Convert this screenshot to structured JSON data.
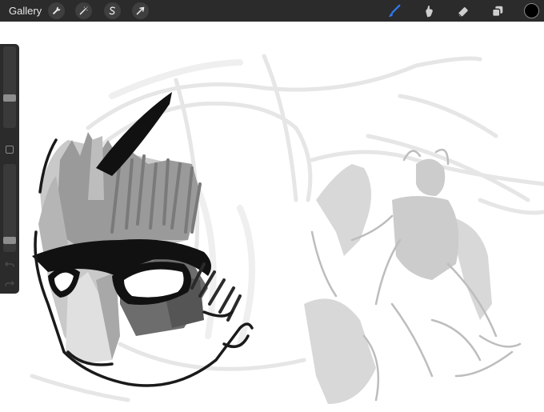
{
  "app": {
    "gallery_label": "Gallery"
  },
  "toolbar": {
    "left_tools": [
      {
        "name": "actions",
        "icon": "wrench-icon"
      },
      {
        "name": "adjustments",
        "icon": "magic-wand-icon"
      },
      {
        "name": "selection",
        "icon": "selection-s-icon"
      },
      {
        "name": "transform",
        "icon": "arrow-cursor-icon"
      }
    ],
    "right_tools": [
      {
        "name": "brush",
        "icon": "brush-icon",
        "active": true
      },
      {
        "name": "smudge",
        "icon": "smudge-finger-icon",
        "active": false
      },
      {
        "name": "eraser",
        "icon": "eraser-icon",
        "active": false
      },
      {
        "name": "layers",
        "icon": "layers-icon",
        "active": false
      }
    ],
    "active_color": "#000000",
    "accent_color": "#2f7bf5"
  },
  "sidebar": {
    "brush_size_level": 0.35,
    "opacity_level": 0.1
  }
}
